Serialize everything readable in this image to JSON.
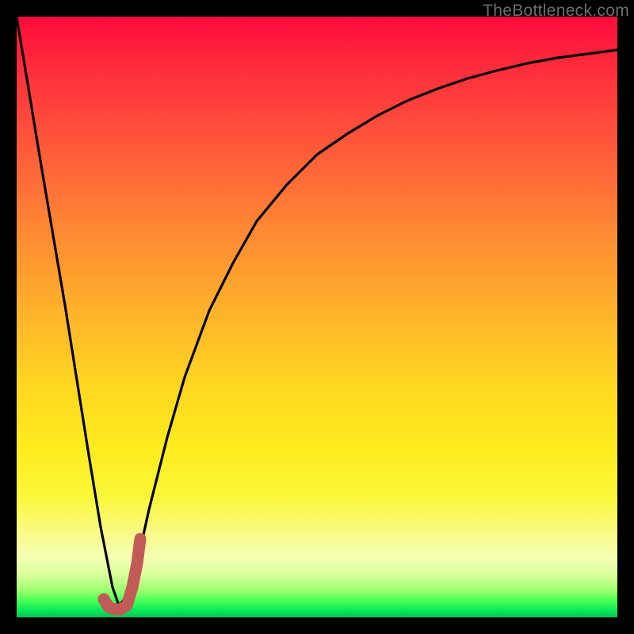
{
  "watermark": "TheBottleneck.com",
  "colors": {
    "frame": "#000000",
    "curve": "#000000",
    "marker": "#c25a57",
    "gradient_top": "#ff0b3a",
    "gradient_bottom": "#03c45a"
  },
  "chart_data": {
    "type": "line",
    "title": "",
    "xlabel": "",
    "ylabel": "",
    "xlim": [
      0,
      100
    ],
    "ylim": [
      0,
      100
    ],
    "grid": false,
    "series": [
      {
        "name": "bottleneck-curve",
        "x": [
          0,
          4,
          8,
          12,
          14,
          16,
          17,
          18,
          20,
          22,
          25,
          28,
          32,
          36,
          40,
          45,
          50,
          55,
          60,
          65,
          70,
          75,
          80,
          85,
          90,
          95,
          100
        ],
        "values": [
          100,
          76,
          52,
          27,
          15,
          5,
          2,
          3,
          9,
          18,
          30,
          40,
          51,
          59,
          66,
          72,
          77,
          80.5,
          83.5,
          86,
          88,
          89.7,
          91,
          92.2,
          93.1,
          93.8,
          94.4
        ]
      }
    ],
    "marker": {
      "name": "highlight-j",
      "x": [
        14.5,
        15.3,
        16.3,
        17.3,
        18.3,
        19.3,
        20.0,
        20.6
      ],
      "y": [
        3.0,
        1.7,
        1.3,
        1.3,
        2.0,
        5.0,
        9.0,
        13.0
      ]
    },
    "background": {
      "type": "vertical-gradient",
      "meaning": "red(high)→green(low) severity scale"
    }
  }
}
